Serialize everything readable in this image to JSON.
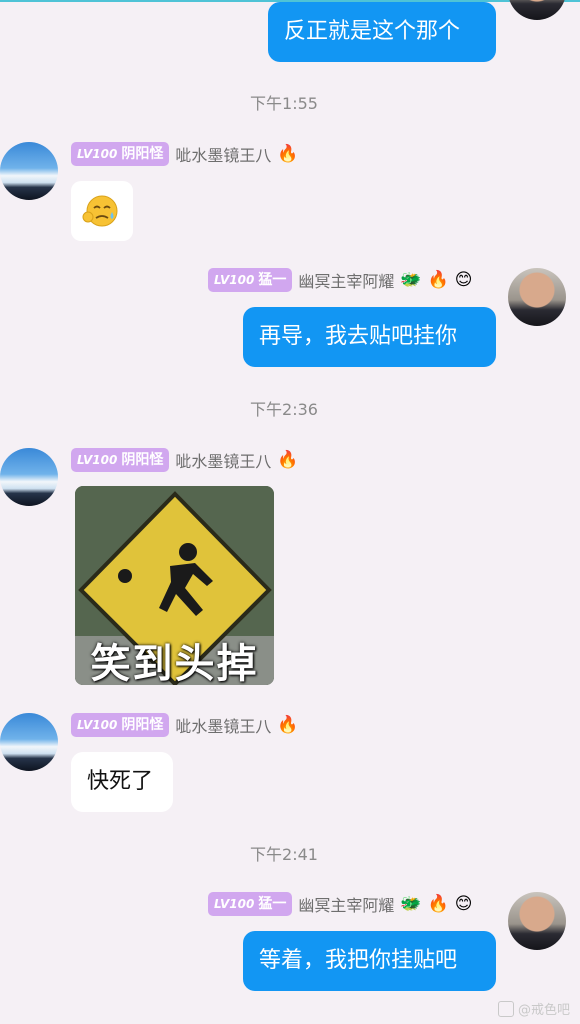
{
  "messages": {
    "m1": "反正就是这个那个",
    "t1": "下午1:55",
    "m3": "再导，我去贴吧挂你",
    "t2": "下午2:36",
    "sign_text": "笑到头掉",
    "m5": "快死了",
    "t3": "下午2:41",
    "m6": "等着，我把你挂贴吧"
  },
  "users": {
    "other": {
      "level": "LV100",
      "title": "阴阳怪",
      "nick": "呲水墨镜王八"
    },
    "me": {
      "level": "LV100",
      "title": "猛一",
      "nick": "幽冥主宰阿耀"
    }
  },
  "emojis": {
    "fire": "🔥",
    "dragon": "🐲",
    "smile": "😊",
    "sweat": "😓"
  },
  "watermark": "@戒色吧",
  "colors": {
    "bubble_out": "#1296f3",
    "badge": "#d1a7ef",
    "background": "#f5f0f5"
  }
}
